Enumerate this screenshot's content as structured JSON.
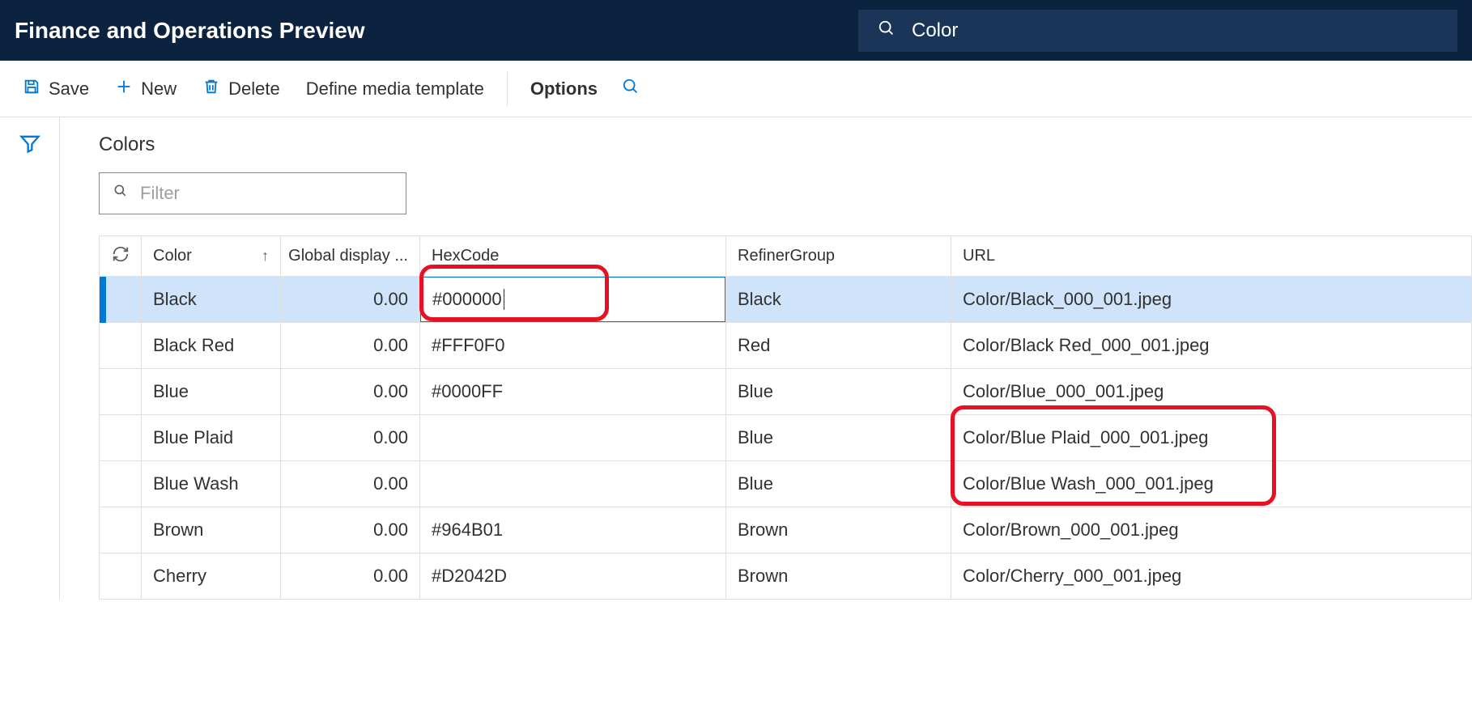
{
  "header": {
    "app_title": "Finance and Operations Preview",
    "search_value": "Color"
  },
  "actions": {
    "save": "Save",
    "new": "New",
    "delete": "Delete",
    "define_media": "Define media template",
    "options": "Options"
  },
  "section": {
    "title": "Colors",
    "filter_placeholder": "Filter"
  },
  "columns": {
    "color": "Color",
    "global_display": "Global display ...",
    "hexcode": "HexCode",
    "refiner_group": "RefinerGroup",
    "url": "URL"
  },
  "rows": [
    {
      "color": "Black",
      "display": "0.00",
      "hex": "#000000",
      "refiner": "Black",
      "url": "Color/Black_000_001.jpeg"
    },
    {
      "color": "Black Red",
      "display": "0.00",
      "hex": "#FFF0F0",
      "refiner": "Red",
      "url": "Color/Black Red_000_001.jpeg"
    },
    {
      "color": "Blue",
      "display": "0.00",
      "hex": "#0000FF",
      "refiner": "Blue",
      "url": "Color/Blue_000_001.jpeg"
    },
    {
      "color": "Blue Plaid",
      "display": "0.00",
      "hex": "",
      "refiner": "Blue",
      "url": "Color/Blue Plaid_000_001.jpeg"
    },
    {
      "color": "Blue Wash",
      "display": "0.00",
      "hex": "",
      "refiner": "Blue",
      "url": "Color/Blue Wash_000_001.jpeg"
    },
    {
      "color": "Brown",
      "display": "0.00",
      "hex": "#964B01",
      "refiner": "Brown",
      "url": "Color/Brown_000_001.jpeg"
    },
    {
      "color": "Cherry",
      "display": "0.00",
      "hex": "#D2042D",
      "refiner": "Brown",
      "url": "Color/Cherry_000_001.jpeg"
    }
  ]
}
